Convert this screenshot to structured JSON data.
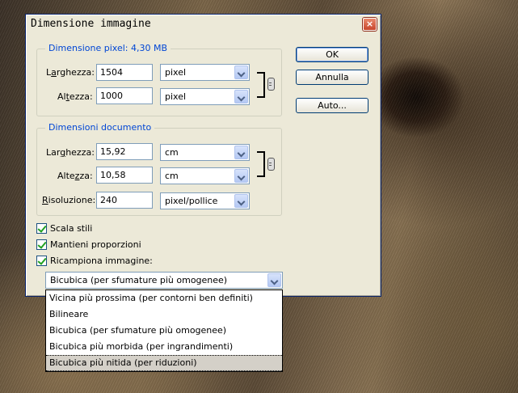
{
  "dialog": {
    "title": "Dimensione immagine",
    "close": "×"
  },
  "pixel_group": {
    "legend": "Dimensione pixel: 4,30 MB",
    "width_label_pre": "L",
    "width_label_u": "a",
    "width_label_post": "rghezza:",
    "width_value": "1504",
    "width_unit": "pixel",
    "height_label_pre": "Al",
    "height_label_u": "t",
    "height_label_post": "ezza:",
    "height_value": "1000",
    "height_unit": "pixel"
  },
  "doc_group": {
    "legend": "Dimensioni documento",
    "width_label_pre": "Lar",
    "width_label_u": "g",
    "width_label_post": "hezza:",
    "width_value": "15,92",
    "width_unit": "cm",
    "height_label_pre": "Alte",
    "height_label_u": "z",
    "height_label_post": "za:",
    "height_value": "10,58",
    "height_unit": "cm",
    "res_label_pre": "",
    "res_label_u": "R",
    "res_label_post": "isoluzione:",
    "res_value": "240",
    "res_unit": "pixel/pollice"
  },
  "buttons": {
    "ok": "OK",
    "cancel": "Annulla",
    "auto": "Auto..."
  },
  "checkboxes": {
    "scale_styles": "Scala stili",
    "constrain": "Mantieni proporzioni",
    "resample": "Ricampiona immagine:"
  },
  "resample": {
    "selected": "Bicubica (per sfumature più omogenee)",
    "options": [
      "Vicina più prossima (per contorni ben definiti)",
      "Bilineare",
      "Bicubica (per sfumature più omogenee)",
      "Bicubica più morbida (per ingrandimenti)",
      "Bicubica più nitida (per riduzioni)"
    ],
    "highlighted_index": 4
  }
}
